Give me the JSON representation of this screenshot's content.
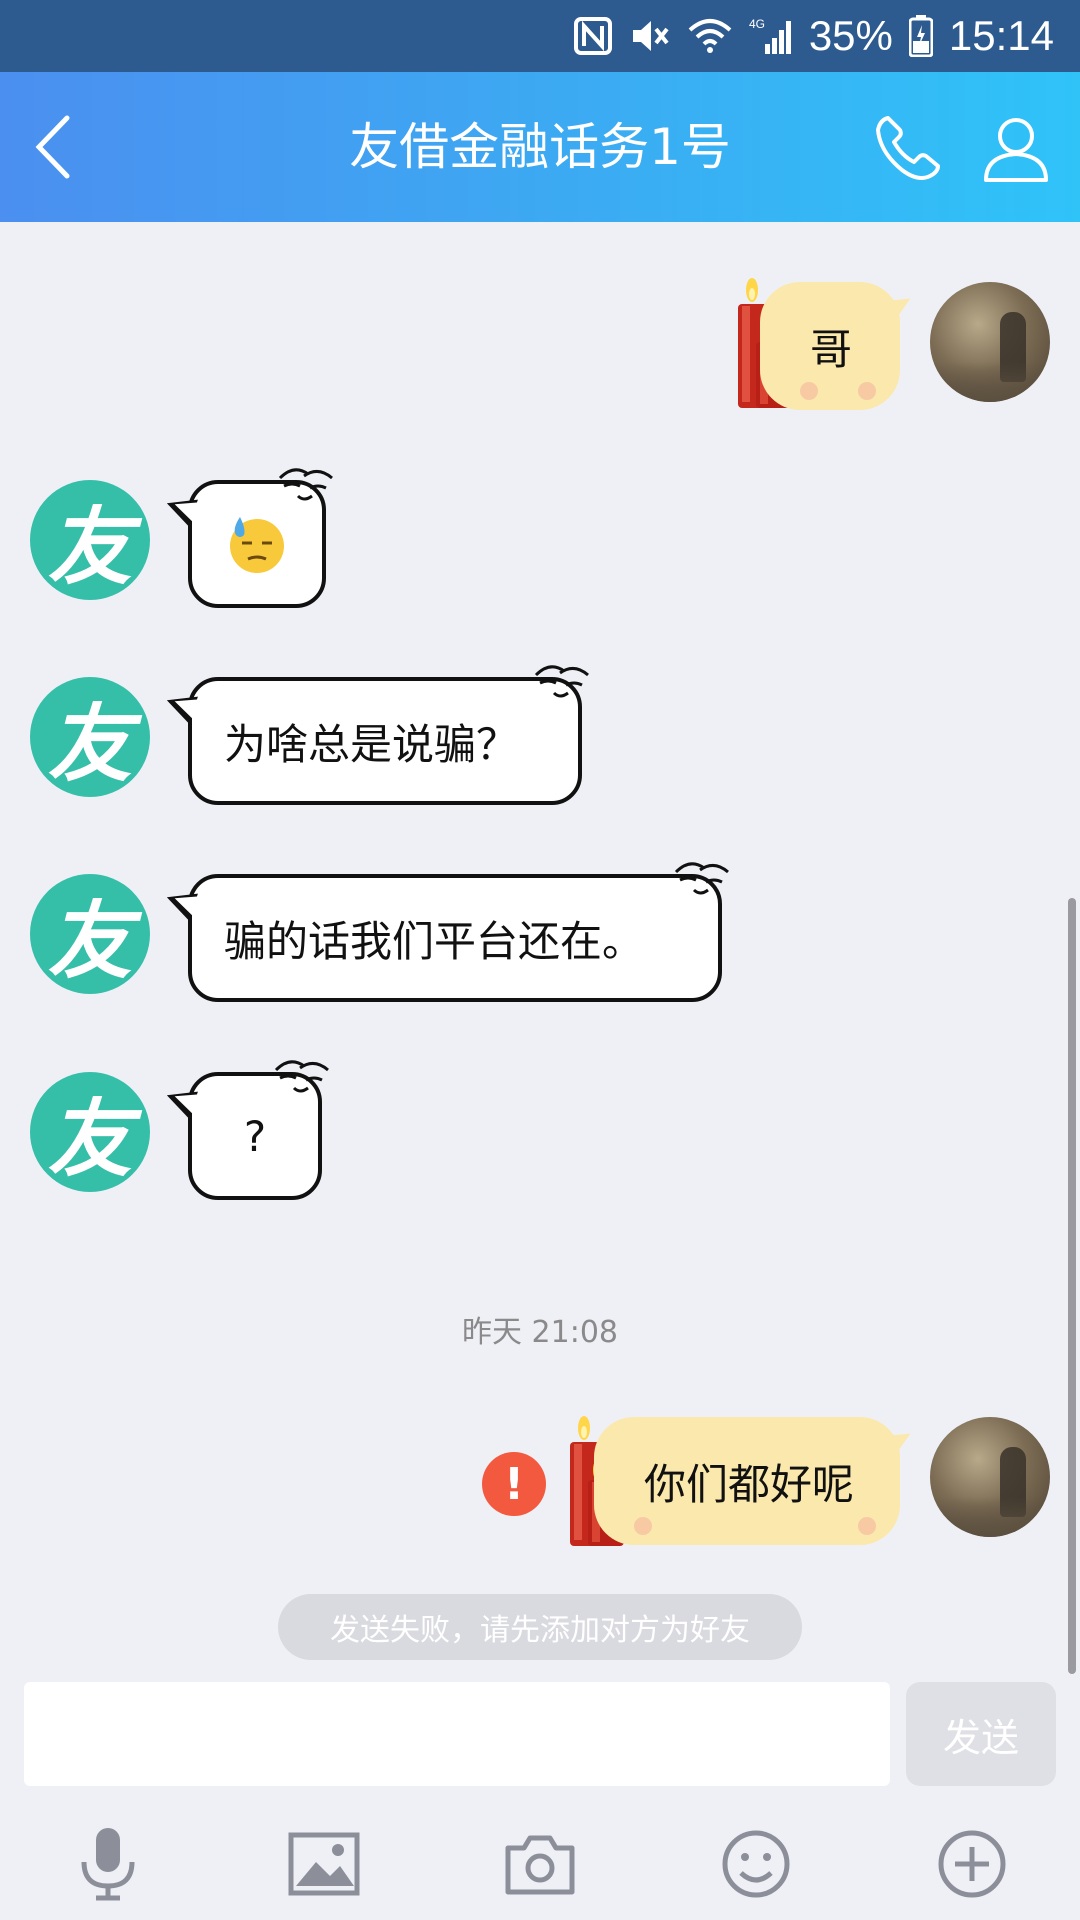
{
  "status_bar": {
    "battery": "35%",
    "time": "15:14",
    "network": "4G",
    "icons": [
      "nfc-icon",
      "mute-icon",
      "wifi-icon",
      "signal-icon",
      "battery-icon"
    ]
  },
  "header": {
    "title": "友借金融话务1号",
    "icons": [
      "back-arrow-icon",
      "phone-icon",
      "profile-icon"
    ]
  },
  "contact": {
    "avatar_char": "友",
    "avatar_color": "#35bfa9"
  },
  "messages": [
    {
      "from": "me",
      "text": "哥"
    },
    {
      "from": "friend",
      "emoji": "sweat-face-emoji"
    },
    {
      "from": "friend",
      "text": "为啥总是说骗？"
    },
    {
      "from": "friend",
      "text": "骗的话我们平台还在。"
    },
    {
      "from": "friend",
      "text": "?"
    },
    {
      "from": "me",
      "text": "你们都好呢",
      "status": "failed"
    }
  ],
  "timestamp": "昨天 21:08",
  "fail_mark": "!",
  "notice": "发送失败，请先添加对方为好友",
  "input": {
    "placeholder": "",
    "send_label": "发送"
  },
  "toolbar": [
    "microphone-icon",
    "image-icon",
    "camera-icon",
    "emoji-icon",
    "plus-icon"
  ],
  "colors": {
    "header_gradient_start": "#4b8ff0",
    "header_gradient_end": "#2fc3f8",
    "outgoing_bubble": "#fbe8ad",
    "fail_red": "#f2593e"
  }
}
